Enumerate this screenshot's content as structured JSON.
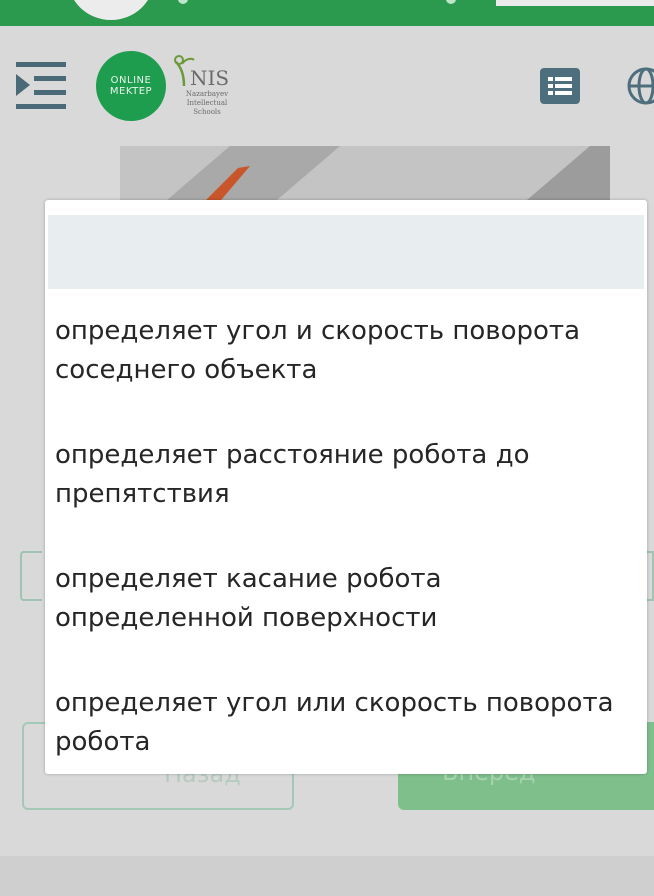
{
  "header": {
    "logo_online": [
      "ONLINE",
      "MEKTEP"
    ],
    "logo_nis": {
      "title": "NIS",
      "subtitle": [
        "Nazarbayev",
        "Intellectual",
        "Schools"
      ]
    },
    "icons": [
      "menu-indent-icon",
      "list-icon",
      "globe-icon"
    ]
  },
  "dropdown": {
    "selected_value": "",
    "options": [
      [
        "определяет угол и скорость поворота",
        "соседнего объекта"
      ],
      [
        "определяет расстояние робота до",
        "препятствия"
      ],
      [
        "определяет касание робота",
        "определенной поверхности"
      ],
      [
        "определяет угол или скорость поворота",
        "робота"
      ]
    ]
  },
  "buttons": {
    "back_label": "Назад",
    "next_label": "Вперед"
  },
  "colors": {
    "brand_green": "#2b9a4e",
    "logo_green": "#1e9d4e",
    "selected_row": "#e8eef0"
  }
}
